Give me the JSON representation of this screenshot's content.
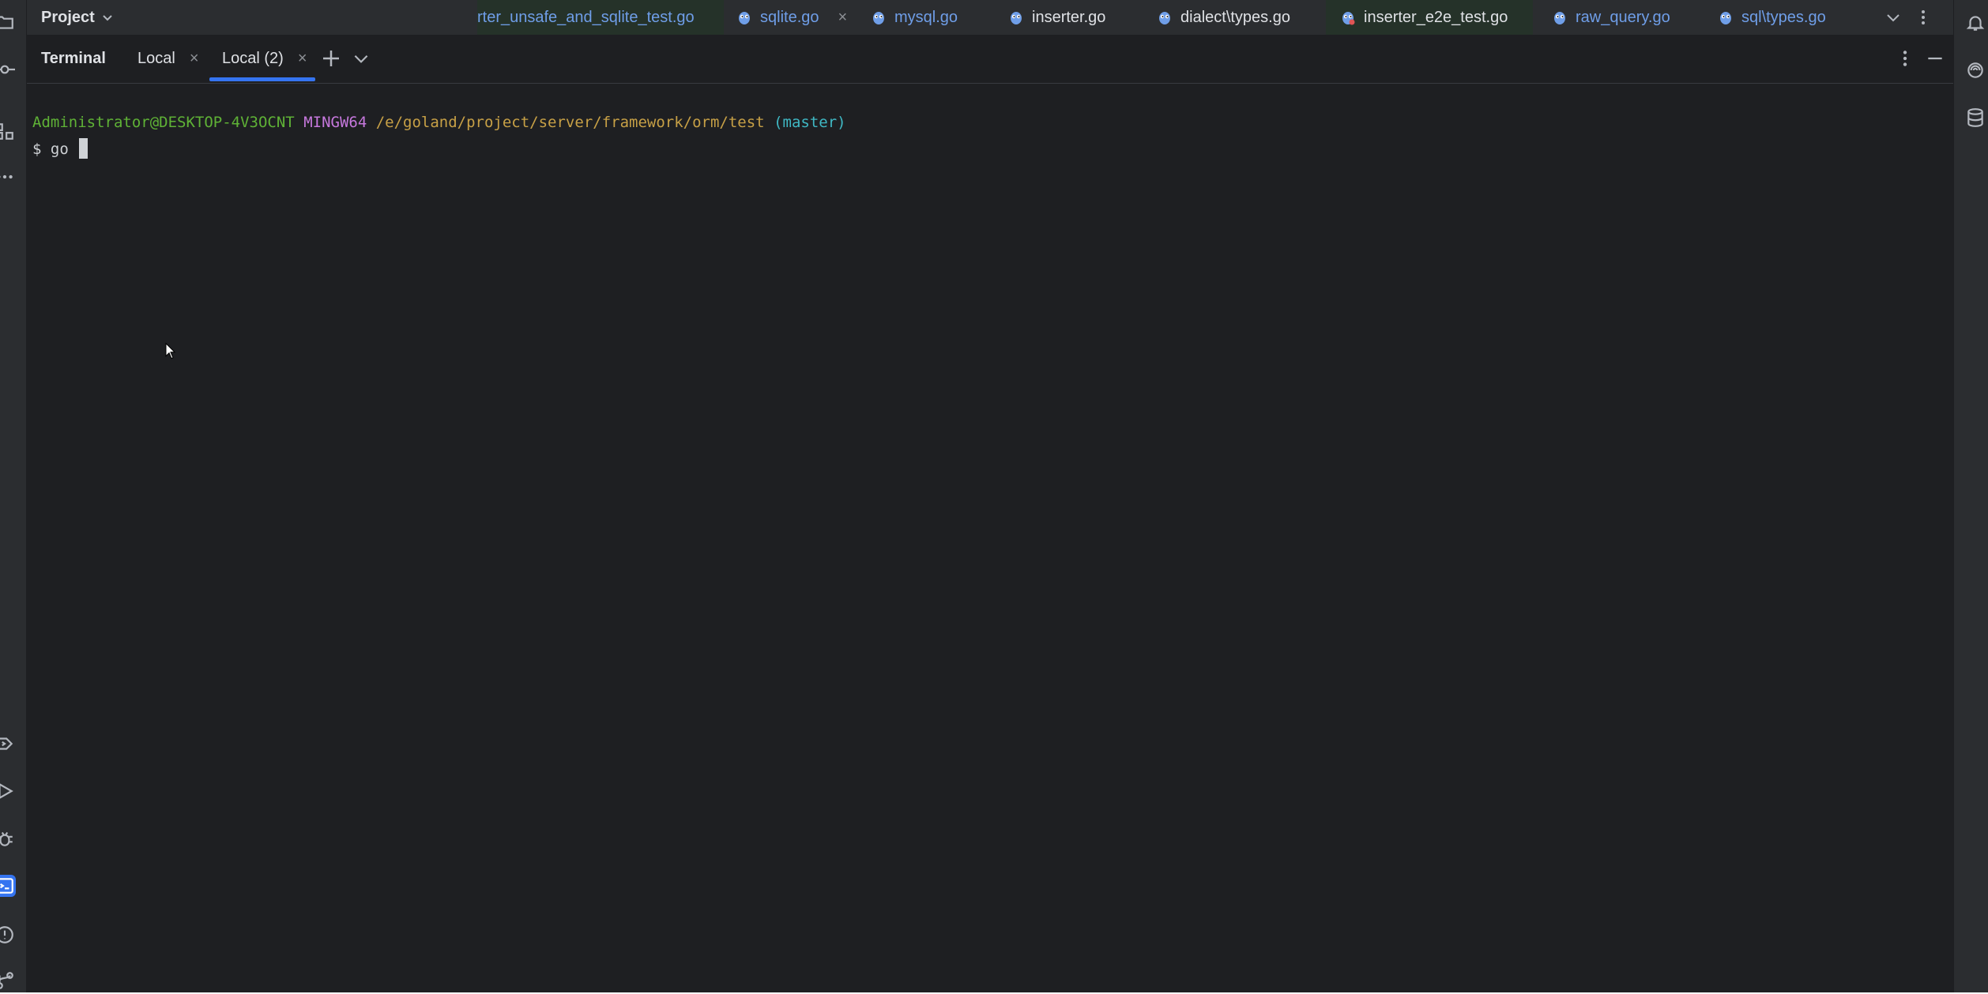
{
  "top_bar": {
    "project_label": "Project",
    "editor_tabs": [
      {
        "label": "rter_unsafe_and_sqlite_test.go",
        "style": "modified-tested"
      },
      {
        "label": "sqlite.go",
        "style": "modified",
        "has_close": true
      },
      {
        "label": "mysql.go",
        "style": "modified"
      },
      {
        "label": "inserter.go",
        "style": "normal"
      },
      {
        "label": "dialect\\types.go",
        "style": "normal"
      },
      {
        "label": "inserter_e2e_test.go",
        "style": "tested"
      },
      {
        "label": "raw_query.go",
        "style": "modified"
      },
      {
        "label": "sql\\types.go",
        "style": "modified"
      }
    ],
    "close_glyph": "×"
  },
  "terminal": {
    "title": "Terminal",
    "tabs": [
      {
        "label": "Local",
        "active": false
      },
      {
        "label": "Local (2)",
        "active": true
      }
    ],
    "close_glyph": "×",
    "prompt": {
      "user_host": "Administrator@DESKTOP-4V3OCNT",
      "system": "MINGW64",
      "path": "/e/goland/project/server/framework/orm/test",
      "branch": "(master)"
    },
    "command_line": "$ go "
  },
  "colors": {
    "background": "#1e1f22",
    "panel": "#2b2d30",
    "accent": "#3574f0",
    "prompt_user": "#5fb236",
    "prompt_system": "#c678dd",
    "prompt_path": "#c7a046",
    "prompt_branch": "#3fb8c4",
    "modified_tab": "#6f9ee8"
  },
  "icons": {
    "left_strip": [
      "project-folder-icon",
      "commit-icon",
      "structure-icon",
      "more-tools-icon",
      "services-icon",
      "run-icon",
      "debug-icon",
      "terminal-icon",
      "problems-icon",
      "git-icon"
    ],
    "right_strip": [
      "notifications-icon",
      "ai-assistant-icon",
      "database-icon"
    ]
  }
}
